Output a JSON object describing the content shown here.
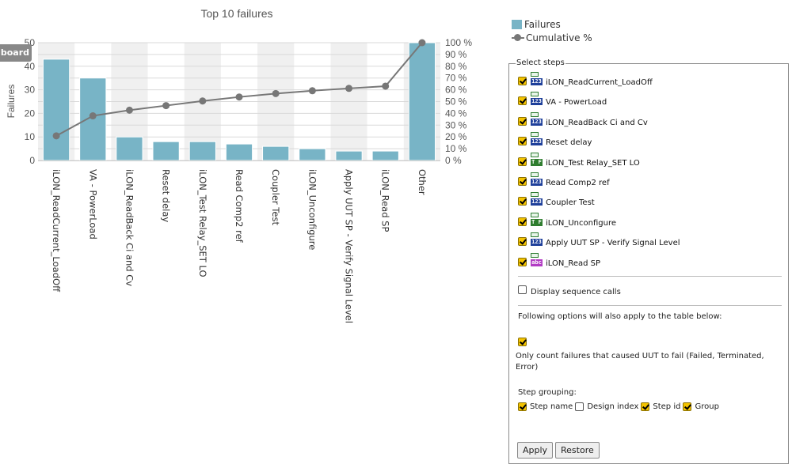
{
  "dashboard_tab": "Dashboard",
  "chart_data": {
    "type": "bar",
    "title": "Top 10 failures",
    "ylabel": "Failures",
    "ylim": [
      0,
      50
    ],
    "y2lim": [
      0,
      100
    ],
    "yticks": [
      0,
      10,
      20,
      30,
      40,
      50
    ],
    "y2ticks": [
      "0 %",
      "10 %",
      "20 %",
      "30 %",
      "40 %",
      "50 %",
      "60 %",
      "70 %",
      "80 %",
      "90 %",
      "100 %"
    ],
    "categories": [
      "iLON_ReadCurrent_LoadOff",
      "VA - PowerLoad",
      "iLON_ReadBack Ci and Cv",
      "Reset delay",
      "iLON_Test Relay_SET LO",
      "Read Comp2 ref",
      "Coupler Test",
      "iLON_Unconfigure",
      "Apply UUT SP - Verify Signal Level",
      "iLON_Read SP",
      "Other"
    ],
    "series": [
      {
        "name": "Failures",
        "type": "bar",
        "color": "#78b4c6",
        "values": [
          43,
          35,
          10,
          8,
          8,
          7,
          6,
          5,
          4,
          4,
          50
        ]
      },
      {
        "name": "Cumulative %",
        "type": "line",
        "color": "#777777",
        "values": [
          20.9,
          37.9,
          42.7,
          46.6,
          50.5,
          53.9,
          56.8,
          59.2,
          61.2,
          63.1,
          100
        ]
      }
    ],
    "grid": true,
    "legend_position": "top-right"
  },
  "panel": {
    "title": "Select steps",
    "steps": [
      {
        "label": "iLON_ReadCurrent_LoadOff",
        "checked": true,
        "type_icon": "123"
      },
      {
        "label": "VA - PowerLoad",
        "checked": true,
        "type_icon": "123"
      },
      {
        "label": "iLON_ReadBack Ci and Cv",
        "checked": true,
        "type_icon": "123"
      },
      {
        "label": "Reset delay",
        "checked": true,
        "type_icon": "123"
      },
      {
        "label": "iLON_Test Relay_SET LO",
        "checked": true,
        "type_icon": "T F"
      },
      {
        "label": "Read Comp2 ref",
        "checked": true,
        "type_icon": "123"
      },
      {
        "label": "Coupler Test",
        "checked": true,
        "type_icon": "123"
      },
      {
        "label": "iLON_Unconfigure",
        "checked": true,
        "type_icon": "T F"
      },
      {
        "label": "Apply UUT SP - Verify Signal Level",
        "checked": true,
        "type_icon": "123"
      },
      {
        "label": "iLON_Read SP",
        "checked": true,
        "type_icon": "abc"
      }
    ],
    "display_sequence_calls": {
      "label": "Display sequence calls",
      "checked": false
    },
    "options_note": "Following options will also apply to the table below:",
    "only_count_failures": {
      "label": "Only count failures that caused UUT to fail (Failed, Terminated, Error)",
      "checked": true
    },
    "step_grouping": {
      "label": "Step grouping:",
      "options": [
        {
          "label": "Step name",
          "checked": true
        },
        {
          "label": "Design index",
          "checked": false
        },
        {
          "label": "Step id",
          "checked": true
        },
        {
          "label": "Group",
          "checked": true
        }
      ]
    },
    "apply_label": "Apply",
    "restore_label": "Restore"
  }
}
